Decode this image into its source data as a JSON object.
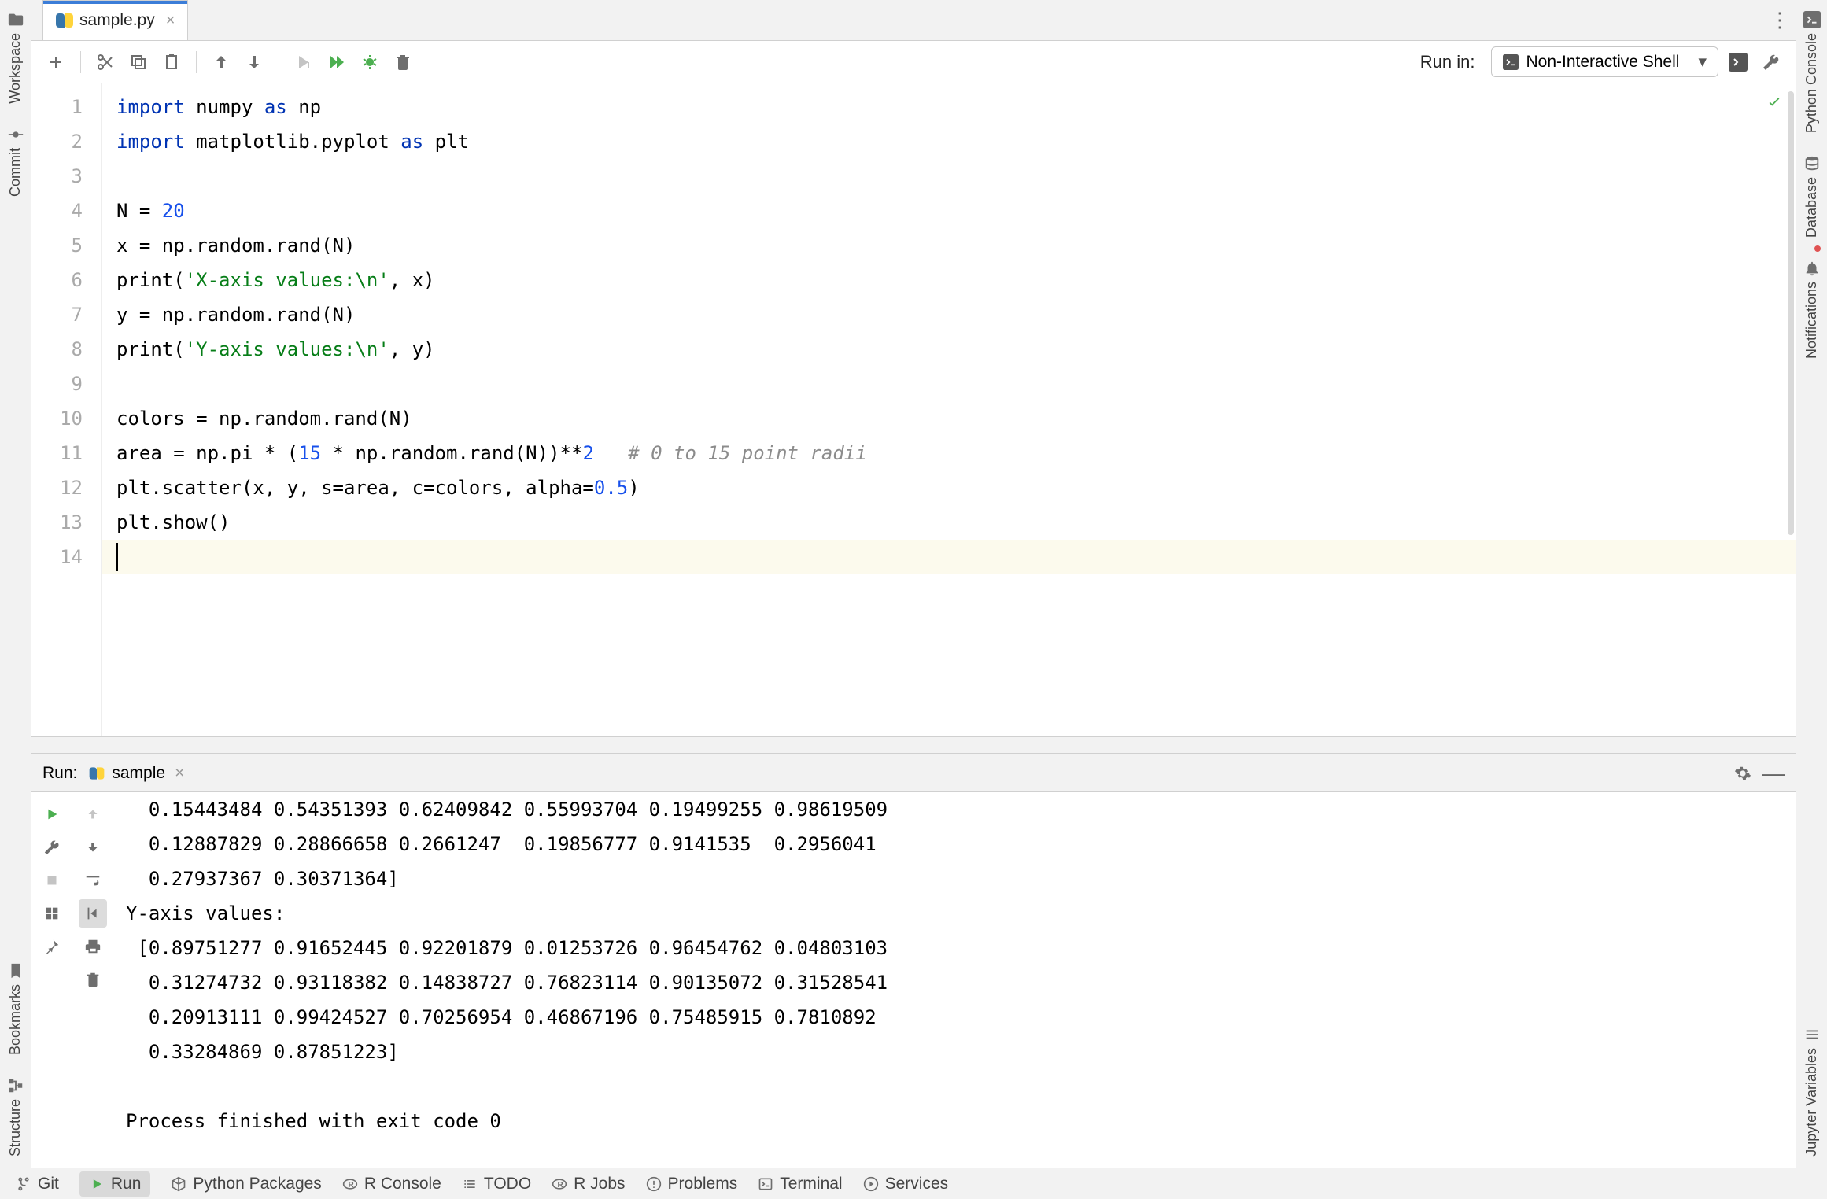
{
  "tab": {
    "filename": "sample.py"
  },
  "toolbar": {
    "run_in_label": "Run in:",
    "runner_name": "Non-Interactive Shell"
  },
  "left_rail": {
    "workspace": "Workspace",
    "commit": "Commit",
    "bookmarks": "Bookmarks",
    "structure": "Structure"
  },
  "right_rail": {
    "python_console": "Python Console",
    "database": "Database",
    "notifications": "Notifications",
    "jupyter_vars": "Jupyter Variables"
  },
  "code": {
    "lines": [
      "import numpy as np",
      "import matplotlib.pyplot as plt",
      "",
      "N = 20",
      "x = np.random.rand(N)",
      "print('X-axis values:\\n', x)",
      "y = np.random.rand(N)",
      "print('Y-axis values:\\n', y)",
      "",
      "colors = np.random.rand(N)",
      "area = np.pi * (15 * np.random.rand(N))**2   # 0 to 15 point radii",
      "plt.scatter(x, y, s=area, c=colors, alpha=0.5)",
      "plt.show()",
      ""
    ]
  },
  "run_tw": {
    "title": "Run:",
    "config": "sample"
  },
  "console_lines": [
    "  0.15443484 0.54351393 0.62409842 0.55993704 0.19499255 0.98619509",
    "  0.12887829 0.28866658 0.2661247  0.19856777 0.9141535  0.2956041",
    "  0.27937367 0.30371364]",
    "Y-axis values:",
    " [0.89751277 0.91652445 0.92201879 0.01253726 0.96454762 0.04803103",
    "  0.31274732 0.93118382 0.14838727 0.76823114 0.90135072 0.31528541",
    "  0.20913111 0.99424527 0.70256954 0.46867196 0.75485915 0.7810892",
    "  0.33284869 0.87851223]",
    "",
    "Process finished with exit code 0"
  ],
  "status": {
    "git": "Git",
    "run": "Run",
    "py_packages": "Python Packages",
    "r_console": "R Console",
    "todo": "TODO",
    "r_jobs": "R Jobs",
    "problems": "Problems",
    "terminal": "Terminal",
    "services": "Services"
  }
}
